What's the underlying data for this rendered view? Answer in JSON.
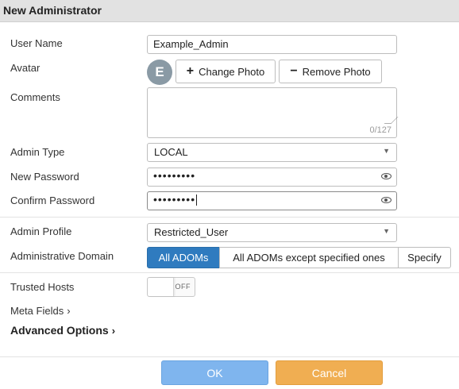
{
  "window": {
    "title": "New Administrator"
  },
  "form": {
    "user_name": {
      "label": "User Name",
      "value": "Example_Admin"
    },
    "avatar": {
      "label": "Avatar",
      "initial": "E",
      "change_label": "Change Photo",
      "remove_label": "Remove Photo"
    },
    "comments": {
      "label": "Comments",
      "value": "",
      "counter": "0/127"
    },
    "admin_type": {
      "label": "Admin Type",
      "value": "LOCAL"
    },
    "new_password": {
      "label": "New Password",
      "masked": "•••••••••"
    },
    "confirm_password": {
      "label": "Confirm Password",
      "masked": "•••••••••"
    },
    "admin_profile": {
      "label": "Admin Profile",
      "value": "Restricted_User"
    },
    "admin_domain": {
      "label": "Administrative Domain",
      "options": [
        "All ADOMs",
        "All ADOMs except specified ones",
        "Specify"
      ],
      "selected": "All ADOMs"
    },
    "trusted_hosts": {
      "label": "Trusted Hosts",
      "state": "OFF"
    },
    "meta_fields": {
      "label": "Meta Fields"
    },
    "advanced_options": {
      "label": "Advanced Options"
    }
  },
  "footer": {
    "ok_label": "OK",
    "cancel_label": "Cancel"
  },
  "colors": {
    "accent": "#2f7bbf",
    "ok": "#7fb5ee",
    "cancel": "#f0ae52"
  },
  "icons": {
    "add": "plus-icon",
    "remove": "minus-icon",
    "reveal": "eye-icon",
    "dropdown": "caret-down-icon",
    "expand": "chevron-right-icon"
  }
}
